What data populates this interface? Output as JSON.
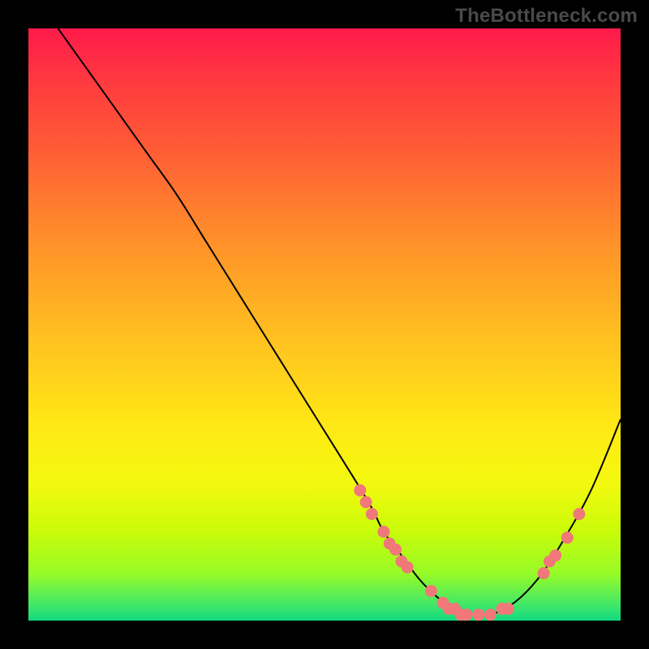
{
  "watermark": "TheBottleneck.com",
  "chart_data": {
    "type": "line",
    "title": "",
    "xlabel": "",
    "ylabel": "",
    "xlim": [
      0,
      100
    ],
    "ylim": [
      0,
      100
    ],
    "series": [
      {
        "name": "curve",
        "x": [
          5,
          10,
          15,
          20,
          25,
          30,
          35,
          40,
          45,
          50,
          55,
          58,
          60,
          63,
          66,
          69,
          72,
          75,
          78,
          82,
          86,
          90,
          95,
          100
        ],
        "y": [
          100,
          93,
          86,
          79,
          72,
          64,
          56,
          48,
          40,
          32,
          24,
          19,
          15,
          11,
          7,
          4,
          2,
          1,
          1,
          3,
          7,
          13,
          22,
          34
        ]
      }
    ],
    "highlight_points": [
      {
        "x": 56,
        "y": 22
      },
      {
        "x": 57,
        "y": 20
      },
      {
        "x": 58,
        "y": 18
      },
      {
        "x": 60,
        "y": 15
      },
      {
        "x": 61,
        "y": 13
      },
      {
        "x": 62,
        "y": 12
      },
      {
        "x": 63,
        "y": 10
      },
      {
        "x": 64,
        "y": 9
      },
      {
        "x": 68,
        "y": 5
      },
      {
        "x": 70,
        "y": 3
      },
      {
        "x": 71,
        "y": 2
      },
      {
        "x": 72,
        "y": 2
      },
      {
        "x": 73,
        "y": 1
      },
      {
        "x": 74,
        "y": 1
      },
      {
        "x": 76,
        "y": 1
      },
      {
        "x": 78,
        "y": 1
      },
      {
        "x": 80,
        "y": 2
      },
      {
        "x": 81,
        "y": 2
      },
      {
        "x": 87,
        "y": 8
      },
      {
        "x": 88,
        "y": 10
      },
      {
        "x": 89,
        "y": 11
      },
      {
        "x": 91,
        "y": 14
      },
      {
        "x": 93,
        "y": 18
      }
    ],
    "colors": {
      "curve": "#000000",
      "highlight": "#f07878",
      "gradient_top": "#ff1a4b",
      "gradient_bottom": "#12d97e"
    }
  }
}
